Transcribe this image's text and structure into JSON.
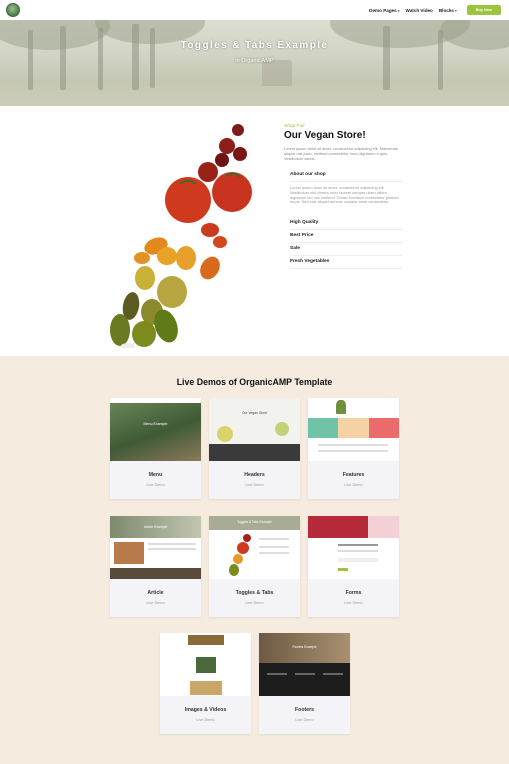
{
  "nav": {
    "items": [
      {
        "label": "Demo Pages",
        "has_caret": true
      },
      {
        "label": "Watch Video",
        "has_caret": false
      },
      {
        "label": "Blocks",
        "has_caret": true
      }
    ],
    "buy_label": "Buy Now",
    "logo_icon": "tree-logo-icon",
    "accent_color": "#9bc53d"
  },
  "hero": {
    "title": "Toggles & Tabs Example",
    "subtitle": "in Organic AMP"
  },
  "store": {
    "kicker": "Shop Fair",
    "title": "Our Vegan Store!",
    "description": "Lorem ipsum dolor sit amet, consectetur adipiscing elit. Maecenas aliquet nisi justo, eleifend consectetur nunc dignissim a quis. Vestibulum varius.",
    "accordion": [
      {
        "label": "About our shop",
        "open": true,
        "body": "Lorem ipsum dolor sit amet, consectetur adipiscing elit. Vestibulum nisi viverra nunc laoreet semper ullam cillent dignissim leo nec eleifend. Donec tincidunt consectetur pretium turpis. Sed erat aliquet aenean sodales amet consectetur."
      },
      {
        "label": "High Quality",
        "open": false
      },
      {
        "label": "Best Price",
        "open": false
      },
      {
        "label": "Sale",
        "open": false
      },
      {
        "label": "Fresh Vegetables",
        "open": false
      }
    ]
  },
  "demos": {
    "title": "Live Demos of OrganicAMP Template",
    "cards": [
      {
        "label": "Menu",
        "link": "Live Demo",
        "thumb_text": "Menu Example"
      },
      {
        "label": "Headers",
        "link": "Live Demo",
        "thumb_text": "Our Vegan Store"
      },
      {
        "label": "Features",
        "link": "Live Demo",
        "thumb_text": ""
      },
      {
        "label": "Article",
        "link": "Live Demo",
        "thumb_text": "Article Example"
      },
      {
        "label": "Toggles & Tabs",
        "link": "Live Demo",
        "thumb_text": "Toggles & Tabs Example"
      },
      {
        "label": "Forms",
        "link": "Live Demo",
        "thumb_text": ""
      },
      {
        "label": "Images & Videos",
        "link": "Live Demo",
        "thumb_text": ""
      },
      {
        "label": "Footers",
        "link": "Live Demo",
        "thumb_text": "Footers Example"
      }
    ]
  }
}
